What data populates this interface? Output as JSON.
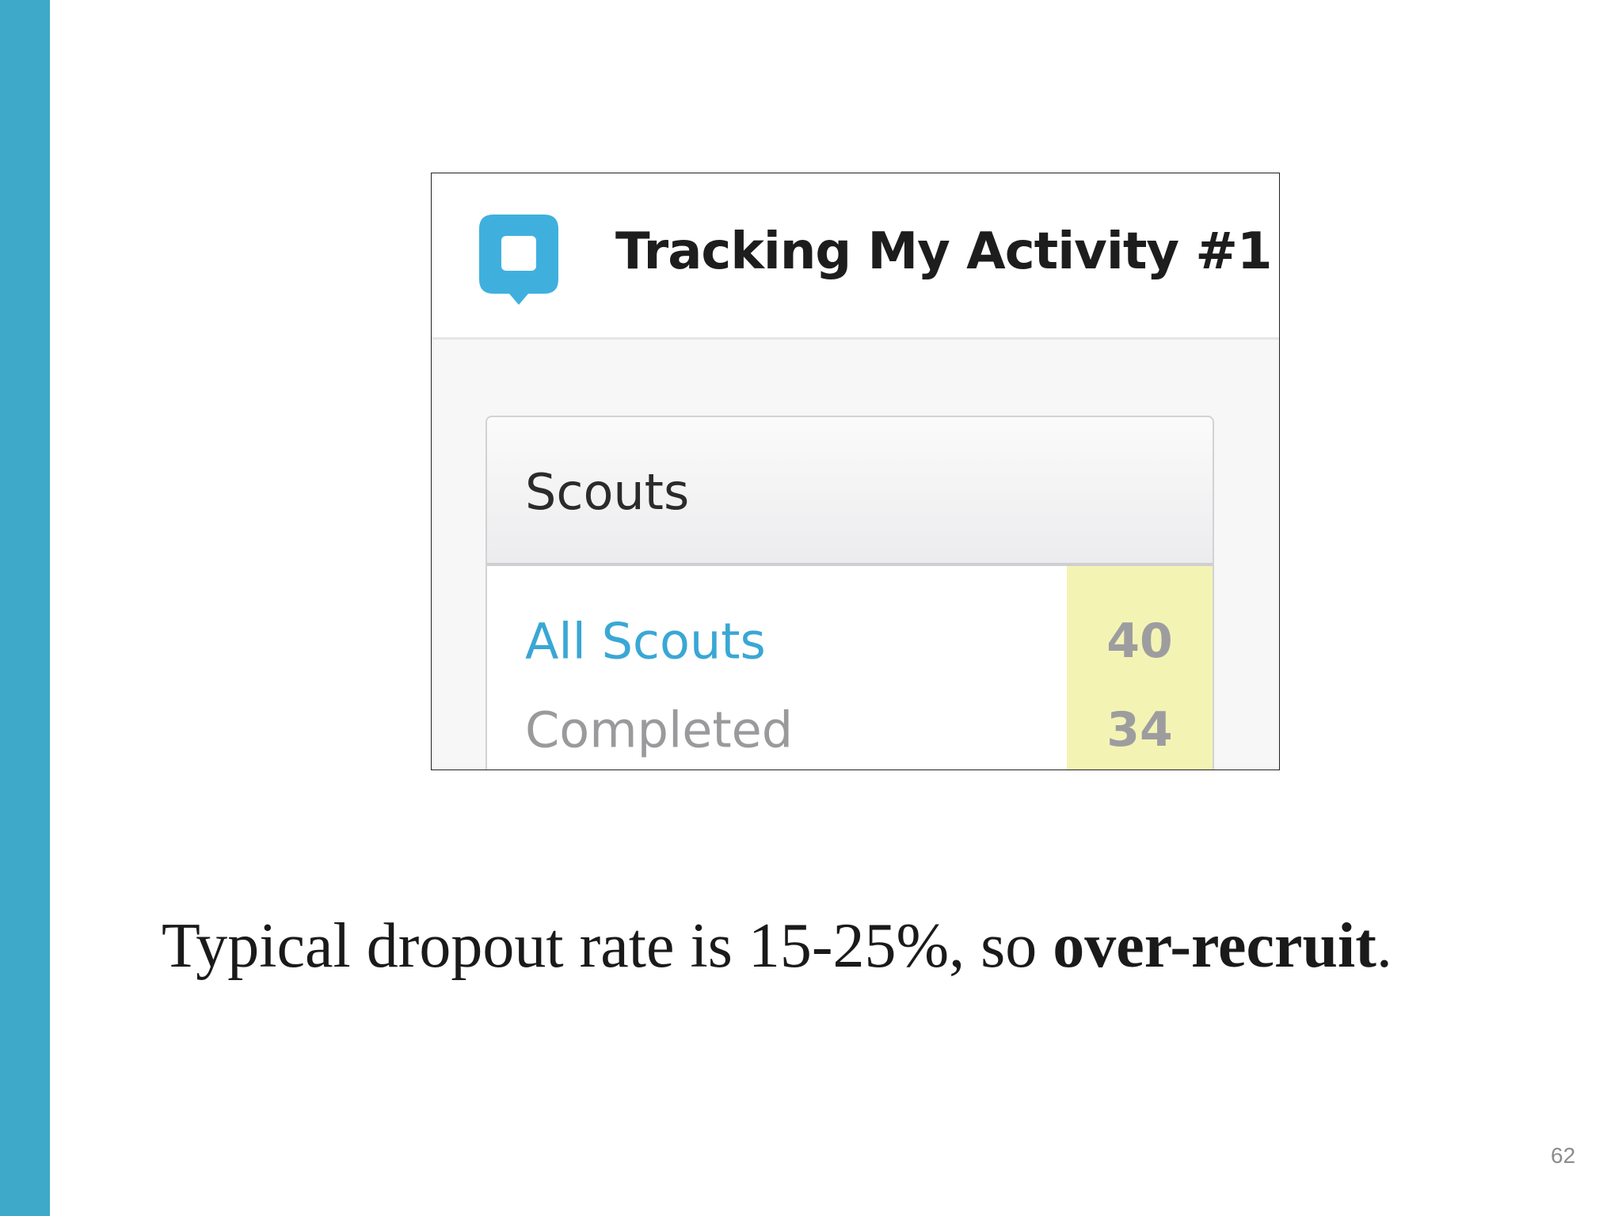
{
  "slide": {
    "accent_color": "#3ea9c8",
    "page_number": "62"
  },
  "screenshot": {
    "app_icon": "speech-bubble-icon",
    "icon_color": "#3fb0de",
    "title": "Tracking My Activity #1",
    "panel": {
      "title": "Scouts",
      "rows": [
        {
          "label": "All Scouts",
          "count": "40"
        },
        {
          "label": "Completed",
          "count": "34"
        }
      ],
      "highlight_color": "#f3f4b4"
    }
  },
  "caption": {
    "text_before": "Typical dropout rate is 15-25%, so ",
    "text_bold": "over-recruit",
    "text_after": "."
  }
}
